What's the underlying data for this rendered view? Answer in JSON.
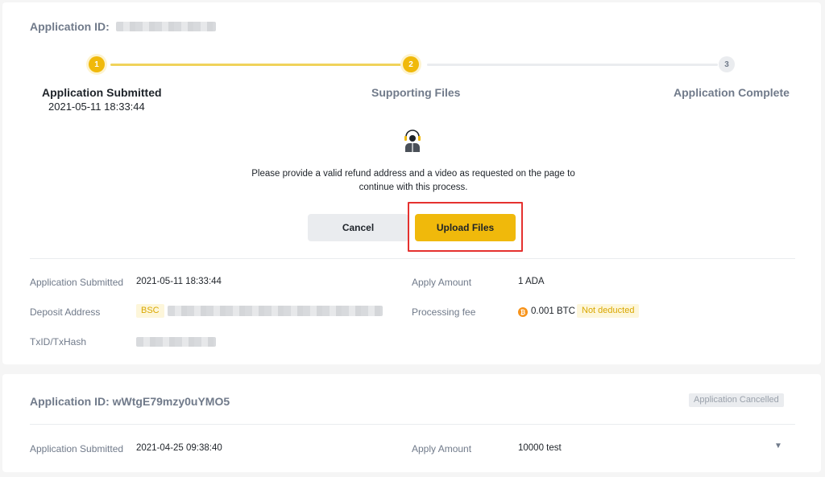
{
  "application1": {
    "id_label": "Application ID:",
    "steps": [
      {
        "number": "1",
        "label": "Application Submitted",
        "date": "2021-05-11 18:33:44"
      },
      {
        "number": "2",
        "label": "Supporting Files"
      },
      {
        "number": "3",
        "label": "Application Complete"
      }
    ],
    "notice": "Please provide a valid refund address and a video as requested on the page to continue with this process.",
    "cancel_label": "Cancel",
    "upload_label": "Upload Files",
    "details": {
      "submitted_label": "Application Submitted",
      "submitted_value": "2021-05-11 18:33:44",
      "deposit_label": "Deposit Address",
      "network_tag": "BSC",
      "txid_label": "TxID/TxHash",
      "amount_label": "Apply Amount",
      "amount_value": "1 ADA",
      "fee_label": "Processing fee",
      "fee_coin_icon": "bitcoin-icon",
      "fee_value": "0.001 BTC",
      "fee_status": "Not deducted"
    }
  },
  "application2": {
    "id_label": "Application ID: wWtgE79mzy0uYMO5",
    "status": "Application Cancelled",
    "submitted_label": "Application Submitted",
    "submitted_value": "2021-04-25 09:38:40",
    "amount_label": "Apply Amount",
    "amount_value": "10000 test",
    "expand_icon": "caret-down-icon"
  },
  "colors": {
    "accent": "#f0b90b",
    "highlight_border": "#e5312f",
    "muted_text": "#707a8a"
  }
}
